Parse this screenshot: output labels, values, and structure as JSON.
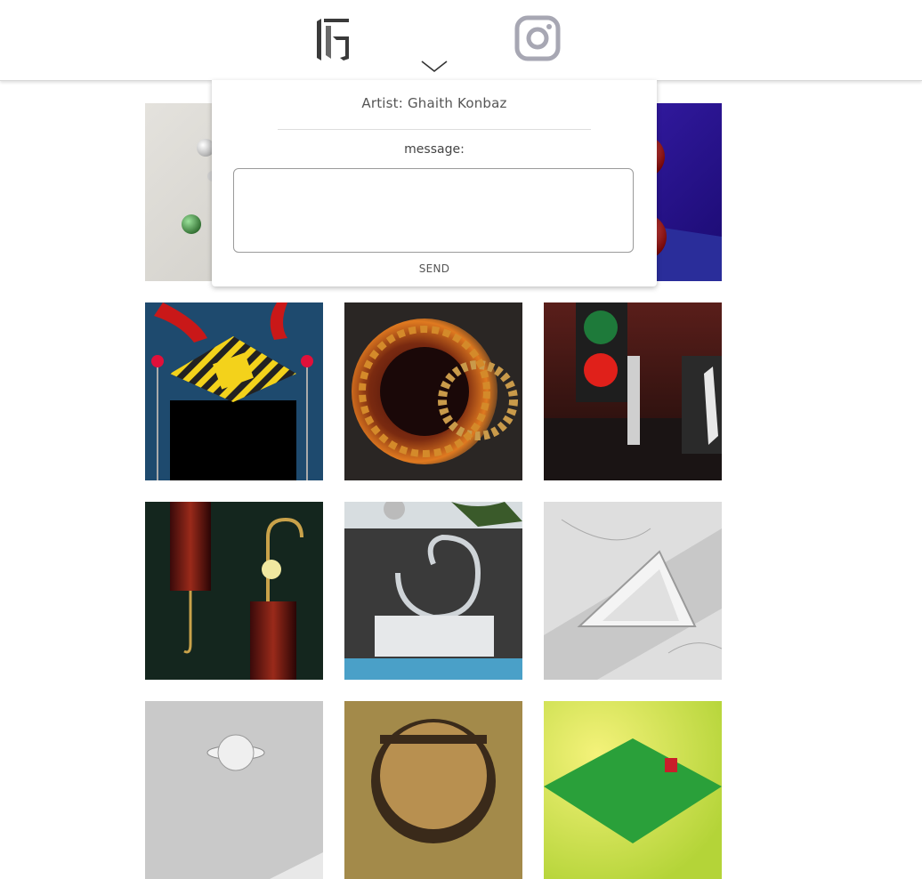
{
  "header": {
    "logo": "brand-logo",
    "toggle_icon": "chevron-down-icon",
    "social_icon": "instagram-icon"
  },
  "contact_popup": {
    "artist_label": "Artist: Ghaith Konbaz",
    "message_label": "message:",
    "message_value": "",
    "send_label": "SEND"
  },
  "gallery": {
    "tiles": [
      {
        "name": "white-spheres-artwork"
      },
      {
        "name": "center-artwork-hidden"
      },
      {
        "name": "red-spheres-purple-artwork"
      },
      {
        "name": "warning-sign-pedestal-artwork"
      },
      {
        "name": "burning-gears-artwork"
      },
      {
        "name": "traffic-light-room-artwork"
      },
      {
        "name": "brass-hooks-artwork"
      },
      {
        "name": "marble-ring-sculpture-artwork"
      },
      {
        "name": "marble-triangle-artwork"
      },
      {
        "name": "white-saturn-artwork"
      },
      {
        "name": "wood-disc-artwork"
      },
      {
        "name": "green-pyramid-artwork"
      }
    ]
  }
}
